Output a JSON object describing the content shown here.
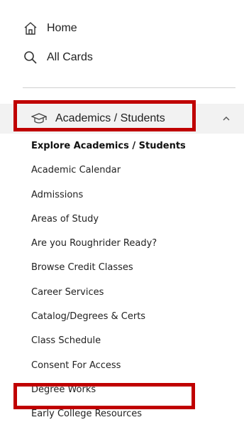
{
  "nav": {
    "home_label": "Home",
    "allcards_label": "All Cards"
  },
  "section": {
    "label": "Academics / Students",
    "expanded": true,
    "items": [
      "Explore Academics / Students",
      "Academic Calendar",
      "Admissions",
      "Areas of Study",
      "Are you Roughrider Ready?",
      "Browse Credit Classes",
      "Career Services",
      "Catalog/Degrees & Certs",
      "Class Schedule",
      "Consent For Access",
      "Degree Works",
      "Early College Resources"
    ]
  },
  "colors": {
    "highlight_box": "#c00000",
    "section_bg": "#f2f2f2"
  }
}
